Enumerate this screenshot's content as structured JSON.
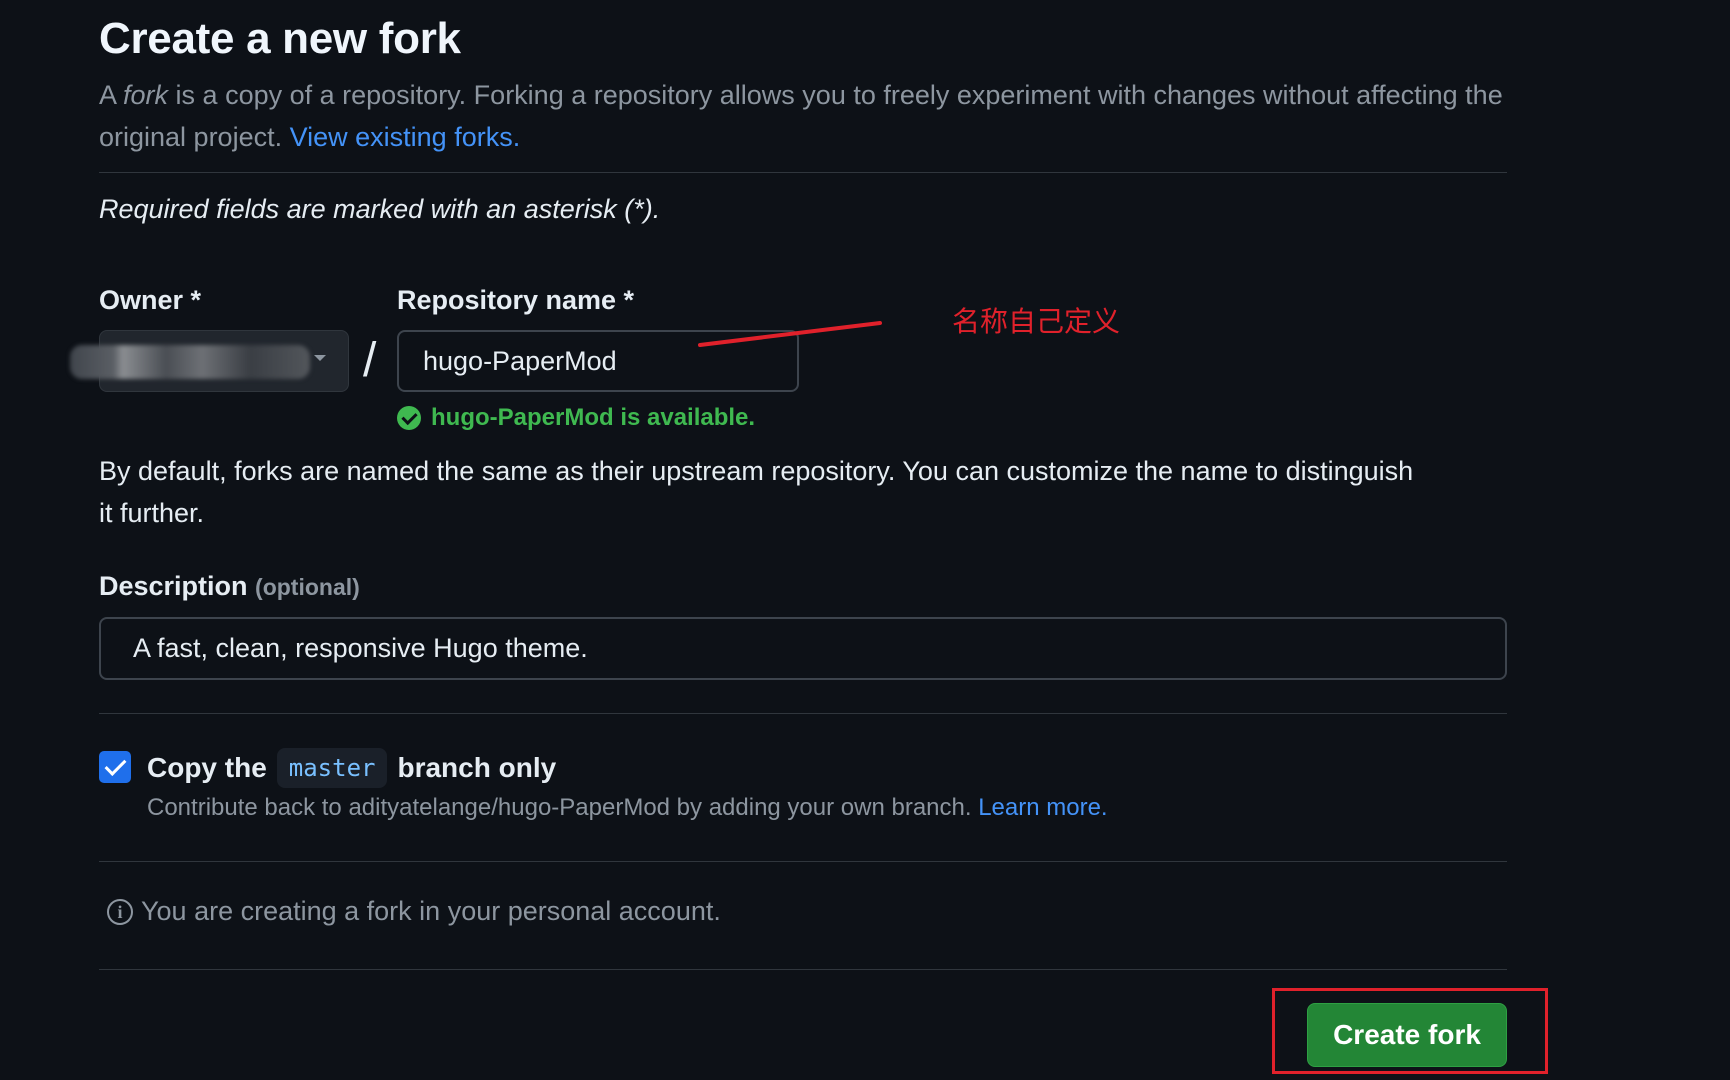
{
  "header": {
    "title": "Create a new fork",
    "intro_prefix": "A ",
    "intro_fork_word": "fork",
    "intro_rest": " is a copy of a repository. Forking a repository allows you to freely experiment with changes without affecting the original project. ",
    "view_forks_link": "View existing forks."
  },
  "form": {
    "required_note": "Required fields are marked with an asterisk (*).",
    "owner": {
      "label": "Owner *"
    },
    "separator": "/",
    "repository": {
      "label": "Repository name *",
      "value": "hugo-PaperMod",
      "availability": "hugo-PaperMod is available."
    },
    "default_note": "By default, forks are named the same as their upstream repository. You can customize the name to distinguish it further.",
    "description": {
      "label": "Description",
      "optional": "(optional)",
      "value": "A fast, clean, responsive Hugo theme."
    },
    "copy_branch": {
      "checked": true,
      "label_prefix": "Copy the",
      "branch": "master",
      "label_suffix": "branch only",
      "subtext": "Contribute back to adityatelange/hugo-PaperMod by adding your own branch. ",
      "learn_more": "Learn more."
    },
    "info": "You are creating a fork in your personal account.",
    "submit_label": "Create fork"
  },
  "annotation": {
    "note": "名称自己定义",
    "color": "#e0212b"
  },
  "colors": {
    "background": "#0d1117",
    "link": "#4493f8",
    "success": "#3fb950",
    "primary_button": "#238636",
    "checkbox": "#1f6feb"
  }
}
